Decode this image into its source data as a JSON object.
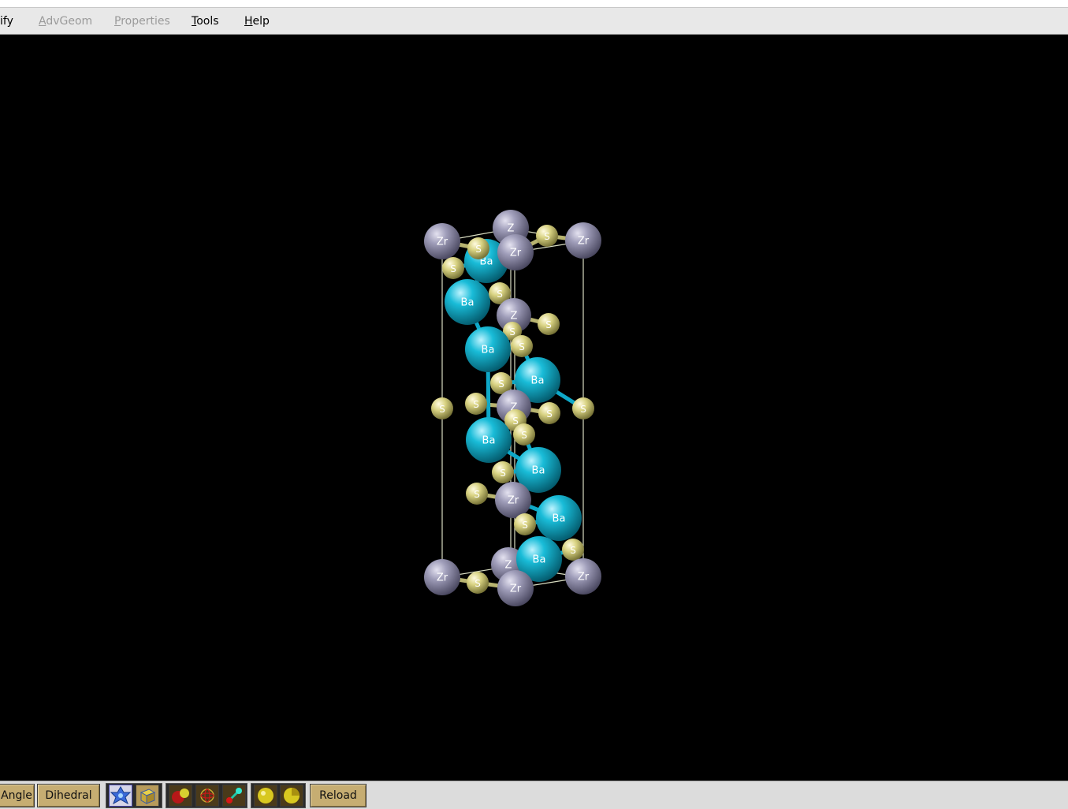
{
  "menubar": {
    "items": [
      {
        "label": "ify",
        "enabled": true
      },
      {
        "label": "AdvGeom",
        "enabled": false
      },
      {
        "label": "Properties",
        "enabled": false
      },
      {
        "label": "Tools",
        "enabled": true
      },
      {
        "label": "Help",
        "enabled": true
      }
    ]
  },
  "structure": {
    "colors": {
      "zr": "#8c8aa6",
      "ba": "#10b6d4",
      "s": "#d6d080",
      "cell": "#d8dcc0"
    },
    "labels": {
      "zr": "Zr",
      "ba": "Ba",
      "s": "S"
    },
    "partial_label": "Z"
  },
  "toolbar": {
    "angle_label": "Angle",
    "dihedral_label": "Dihedral",
    "reload_label": "Reload",
    "icons": [
      "cell-view-icon",
      "cell-box-icon",
      "ball-stick-icon",
      "wireframe-icon",
      "bond-icon",
      "sphere-icon",
      "sphere-cut-icon"
    ]
  }
}
